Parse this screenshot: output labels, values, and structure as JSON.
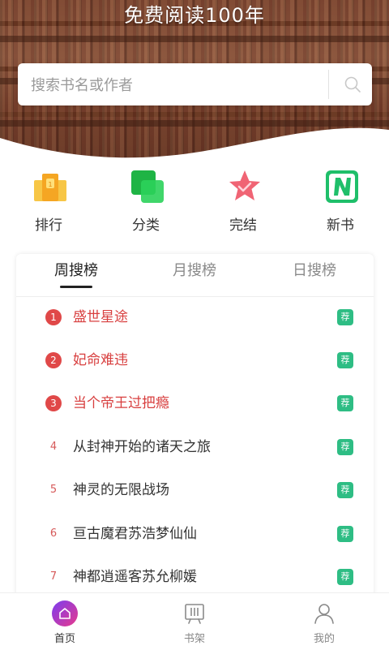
{
  "header": {
    "title": "免费阅读100年"
  },
  "search": {
    "placeholder": "搜索书名或作者",
    "value": ""
  },
  "quick_links": [
    {
      "label": "排行",
      "icon": "trophy-icon",
      "color": "#f5b82e"
    },
    {
      "label": "分类",
      "icon": "category-squares-icon",
      "color": "#22c04a"
    },
    {
      "label": "完结",
      "icon": "star-check-icon",
      "color": "#ef5a6a"
    },
    {
      "label": "新书",
      "icon": "new-n-icon",
      "color": "#1fbf6a"
    }
  ],
  "ranking": {
    "tabs": [
      {
        "label": "周搜榜",
        "active": true
      },
      {
        "label": "月搜榜",
        "active": false
      },
      {
        "label": "日搜榜",
        "active": false
      }
    ],
    "tag_label": "荐",
    "items": [
      {
        "rank": "1",
        "title": "盛世星途"
      },
      {
        "rank": "2",
        "title": "妃命难违"
      },
      {
        "rank": "3",
        "title": "当个帝王过把瘾"
      },
      {
        "rank": "4",
        "title": "从封神开始的诸天之旅"
      },
      {
        "rank": "5",
        "title": "神灵的无限战场"
      },
      {
        "rank": "6",
        "title": "亘古魔君苏浩梦仙仙"
      },
      {
        "rank": "7",
        "title": "神都逍遥客苏允柳媛"
      }
    ]
  },
  "bottom_nav": [
    {
      "label": "首页",
      "icon": "home-icon",
      "active": true
    },
    {
      "label": "书架",
      "icon": "bookshelf-icon",
      "active": false
    },
    {
      "label": "我的",
      "icon": "user-icon",
      "active": false
    }
  ],
  "colors": {
    "accent_red": "#e04848",
    "tag_green": "#2ebd84",
    "header_brown": "#7b4431",
    "home_gradient_start": "#7b3cf0",
    "home_gradient_end": "#e83a8c"
  }
}
